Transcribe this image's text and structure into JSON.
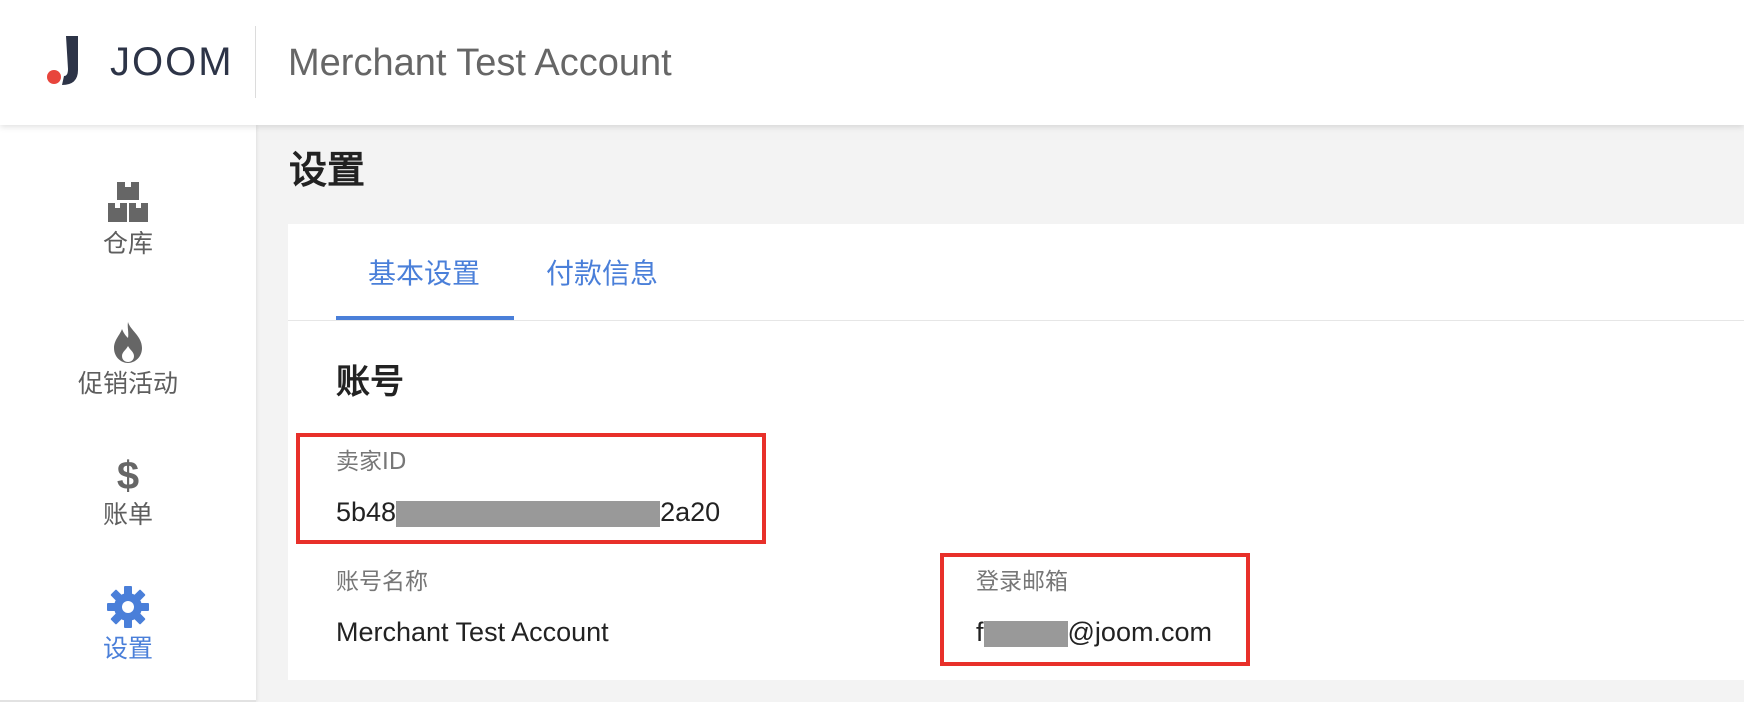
{
  "header": {
    "logo_text": "JOOM",
    "account_title": "Merchant Test Account"
  },
  "sidebar": {
    "items": [
      {
        "label": "仓库",
        "icon": "warehouse-icon"
      },
      {
        "label": "促销活动",
        "icon": "flame-icon"
      },
      {
        "label": "账单",
        "icon": "dollar-icon"
      },
      {
        "label": "设置",
        "icon": "gear-icon",
        "active": true
      }
    ]
  },
  "page": {
    "title": "设置"
  },
  "tabs": [
    {
      "label": "基本设置",
      "active": true
    },
    {
      "label": "付款信息",
      "active": false
    }
  ],
  "account_section": {
    "title": "账号",
    "seller_id": {
      "label": "卖家ID",
      "value_prefix": "5b48",
      "value_suffix": "2a20"
    },
    "account_name": {
      "label": "账号名称",
      "value": "Merchant Test Account"
    },
    "login_email": {
      "label": "登录邮箱",
      "value_prefix": "f",
      "value_suffix": "@joom.com"
    }
  },
  "colors": {
    "accent": "#4a7fd9",
    "highlight": "#e8302a",
    "logo_dot": "#e8453c"
  }
}
